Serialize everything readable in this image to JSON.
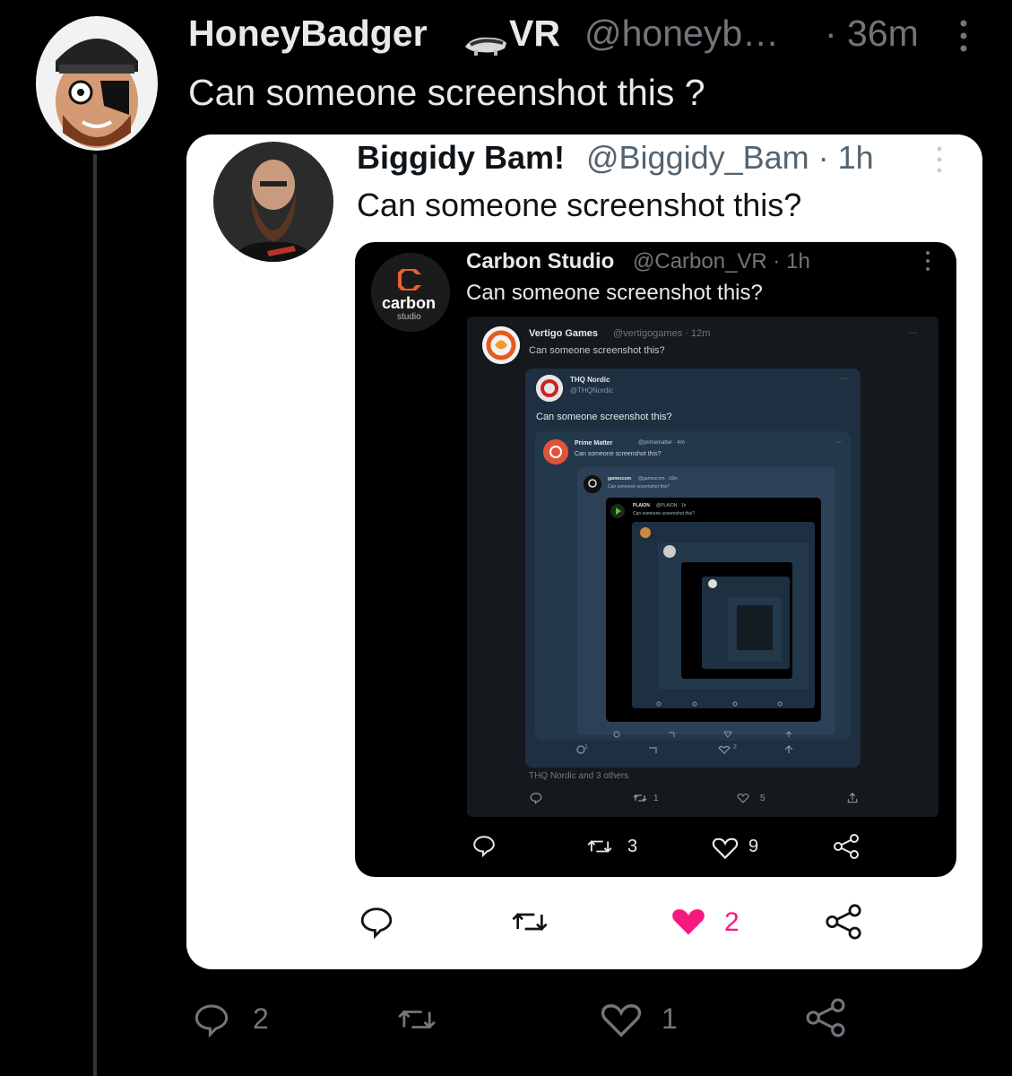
{
  "outer": {
    "name": "HoneyBadger",
    "name_suffix": "VR",
    "handle": "@honeyb…",
    "time": "· 36m",
    "text": "Can someone screenshot this ?",
    "actions": {
      "replies": "2",
      "retweets": "",
      "likes": "1"
    }
  },
  "quote1": {
    "name": "Biggidy Bam!",
    "handle": "@Biggidy_Bam · 1h",
    "text": "Can someone screenshot this?",
    "actions": {
      "likes": "2"
    },
    "colors": {
      "like": "#f91880"
    }
  },
  "quote2": {
    "name": "Carbon Studio",
    "handle": "@Carbon_VR · 1h",
    "text": "Can someone screenshot this?",
    "logo_text": "carbon",
    "logo_sub": "studio",
    "actions": {
      "retweets": "3",
      "likes": "9"
    }
  },
  "quote3": {
    "name": "Vertigo Games",
    "handle": "@vertigogames · 12m",
    "text": "Can someone screenshot this?",
    "more": "···",
    "liked_by": "THQ Nordic and 3 others",
    "actions": {
      "retweets": "1",
      "likes": "5"
    }
  },
  "quote4": {
    "name": "THQ Nordic",
    "handle": "@THQNordic",
    "text": "Can someone screenshot this?",
    "more": "···",
    "actions": {
      "replies": "1",
      "likes": "2"
    }
  },
  "quote5": {
    "name": "Prime Matter",
    "handle": "@primematter · 4m",
    "text": "Can someone screenshot this?",
    "more": "···"
  },
  "quote6": {
    "name": "gamescom",
    "handle": "@gamescom · 10m",
    "text": "Can someone screenshot this?"
  },
  "quote7": {
    "name": "PLAION",
    "handle": "@PLAION · 1h",
    "text": "Can someone screenshot this?"
  }
}
